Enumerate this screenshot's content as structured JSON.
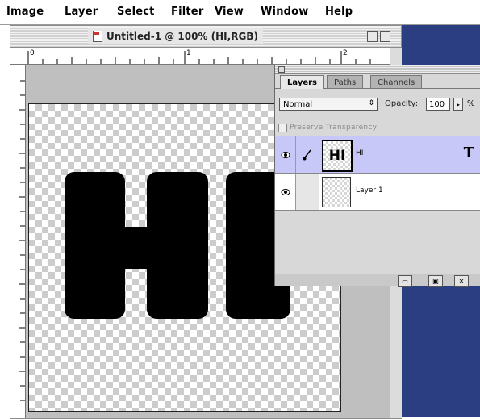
{
  "menubar": {
    "items": [
      "Image",
      "Layer",
      "Select",
      "Filter",
      "View",
      "Window",
      "Help"
    ]
  },
  "document": {
    "title": "Untitled-1 @ 100% (HI,RGB)",
    "ruler_labels": [
      "0",
      "1",
      "2"
    ],
    "canvas_text": "HI"
  },
  "layers_palette": {
    "tabs": [
      "Layers",
      "Paths",
      "Channels"
    ],
    "active_tab": "Layers",
    "blend_mode": "Normal",
    "opacity_label": "Opacity:",
    "opacity_value": "100",
    "opacity_unit": "%",
    "preserve_transparency_label": "Preserve Transparency",
    "layers": [
      {
        "name": "HI",
        "thumb_text": "HI",
        "selected": true,
        "type_layer": true,
        "type_badge": "T"
      },
      {
        "name": "Layer 1",
        "thumb_text": "",
        "selected": false,
        "type_layer": false
      }
    ]
  },
  "colors": {
    "desktop": "#2c3e82",
    "selection": "#c8c8f8"
  },
  "icons": {
    "eye": "eye-icon",
    "brush": "paintbrush-icon",
    "type": "type-layer-icon",
    "new_layer": "new-layer-icon",
    "trash": "trash-icon",
    "mask": "layer-mask-icon"
  }
}
